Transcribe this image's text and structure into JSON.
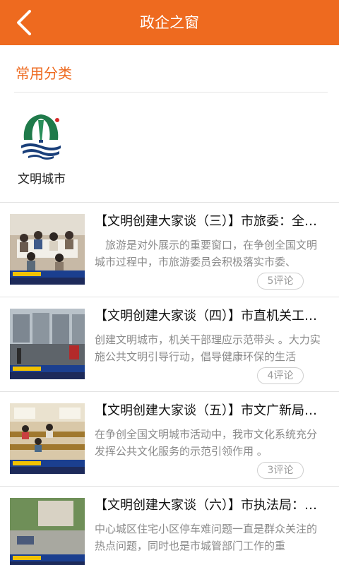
{
  "colors": {
    "accent": "#ee6a1f",
    "text": "#111111",
    "muted": "#8a8a8a"
  },
  "header": {
    "title": "政企之窗",
    "back_icon": "chevron-left-icon"
  },
  "section": {
    "title": "常用分类"
  },
  "categories": [
    {
      "label": "文明城市",
      "icon": "city-emblem-logo"
    }
  ],
  "articles": [
    {
      "title": "【文明创建大家谈（三）】市旅委：全国文明城市",
      "summary": "　旅游是对外展示的重要窗口，在争创全国文明城市过程中，市旅游委员会积极落实市委、",
      "comments": "5评论"
    },
    {
      "title": "【文明创建大家谈（四）】市直机关工委：机关干部",
      "summary": "创建文明城市，机关干部理应示范带头 。大力实施公共文明引导行动，倡导健康环保的生活",
      "comments": "4评论"
    },
    {
      "title": "【文明创建大家谈（五）】市文广新局：文化服务",
      "summary": "在争创全国文明城市活动中，我市文化系统充分发挥公共文化服务的示范引领作用 。",
      "comments": "3评论"
    },
    {
      "title": "【文明创建大家谈（六）】市执法局：停车整治",
      "summary": "中心城区住宅小区停车难问题一直是群众关注的热点问题，同时也是市城管部门工作的重",
      "comments": ""
    }
  ]
}
